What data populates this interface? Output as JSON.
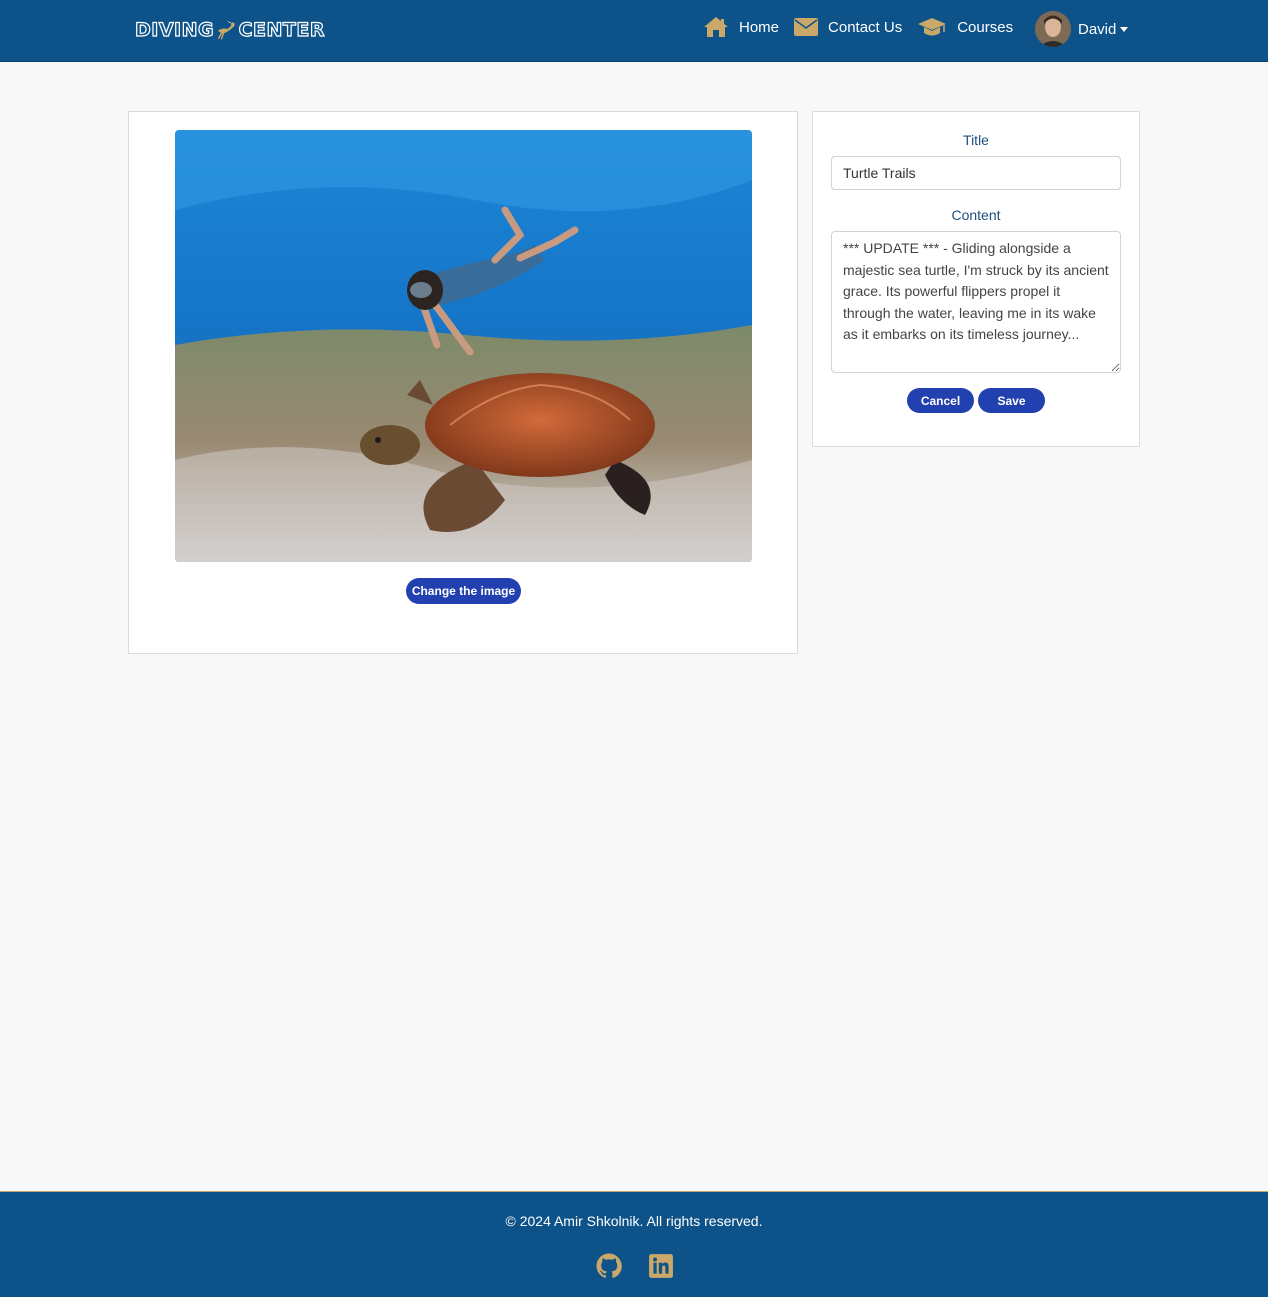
{
  "brand": {
    "part1": "DIVING",
    "part2": "CENTER",
    "accent_color": "#c9a86a",
    "logo_icon": "scuba-diver-icon"
  },
  "nav": {
    "items": [
      {
        "label": "Home",
        "icon": "home-icon"
      },
      {
        "label": "Contact Us",
        "icon": "envelope-icon"
      },
      {
        "label": "Courses",
        "icon": "graduation-cap-icon"
      }
    ],
    "user": {
      "name": "David",
      "icon": "avatar"
    }
  },
  "post": {
    "image_alt": "Snorkeler swimming above a sea turtle",
    "change_image_label": "Change the image"
  },
  "form": {
    "title_label": "Title",
    "title_value": "Turtle Trails",
    "content_label": "Content",
    "content_value": "*** UPDATE *** - Gliding alongside a majestic sea turtle, I'm struck by its ancient grace. Its powerful flippers propel it through the water, leaving me in its wake as it embarks on its timeless journey...",
    "cancel_label": "Cancel",
    "save_label": "Save"
  },
  "footer": {
    "copyright": "© 2024 Amir Shkolnik. All rights reserved.",
    "links": [
      {
        "icon": "github-icon"
      },
      {
        "icon": "linkedin-icon"
      }
    ]
  },
  "colors": {
    "primary": "#0d5288",
    "button": "#2240b0",
    "accent": "#c9a86a",
    "background": "#f8f8f8"
  }
}
